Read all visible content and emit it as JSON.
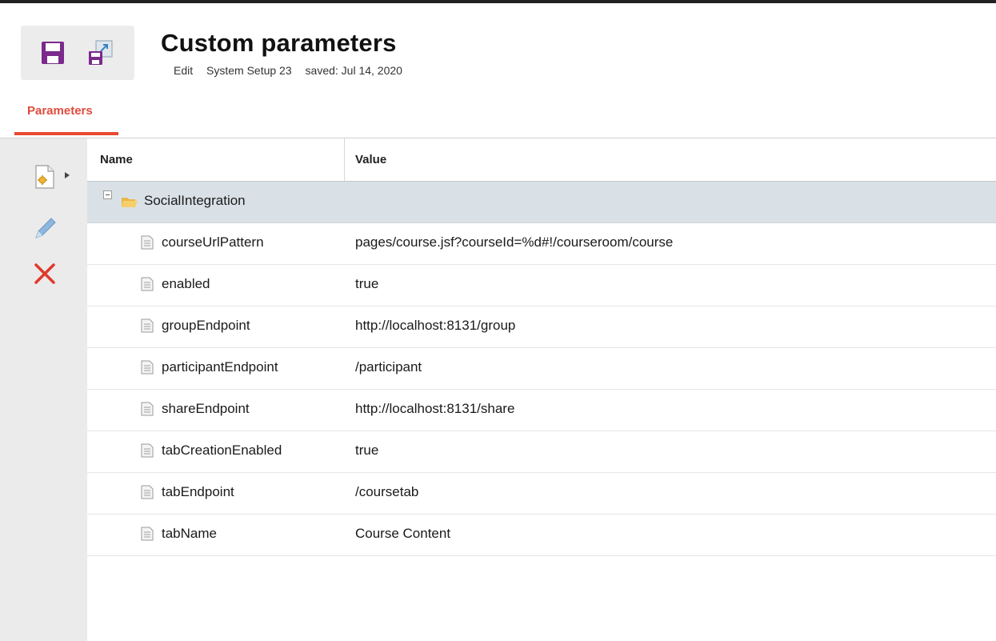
{
  "header": {
    "title": "Custom parameters",
    "subline": {
      "mode": "Edit",
      "context": "System Setup 23",
      "saved": "saved: Jul 14, 2020"
    },
    "icons": {
      "save": "save-icon",
      "save_as": "save-as-icon"
    },
    "colors": {
      "save_icon": "#7b2a8c",
      "accent": "#e8492f"
    }
  },
  "tabs": [
    {
      "label": "Parameters",
      "active": true
    }
  ],
  "toolbar": {
    "icons": [
      "new-parameter-icon",
      "dropdown-arrow-icon",
      "edit-pencil-icon",
      "delete-icon"
    ]
  },
  "grid": {
    "columns": {
      "name": "Name",
      "value": "Value"
    },
    "group": {
      "label": "SocialIntegration",
      "expanded": true
    },
    "rows": [
      {
        "name": "courseUrlPattern",
        "value": "pages/course.jsf?courseId=%d#!/courseroom/course"
      },
      {
        "name": "enabled",
        "value": "true"
      },
      {
        "name": "groupEndpoint",
        "value": "http://localhost:8131/group"
      },
      {
        "name": "participantEndpoint",
        "value": "/participant"
      },
      {
        "name": "shareEndpoint",
        "value": "http://localhost:8131/share"
      },
      {
        "name": "tabCreationEnabled",
        "value": "true"
      },
      {
        "name": "tabEndpoint",
        "value": "/coursetab"
      },
      {
        "name": "tabName",
        "value": "Course Content"
      }
    ]
  }
}
